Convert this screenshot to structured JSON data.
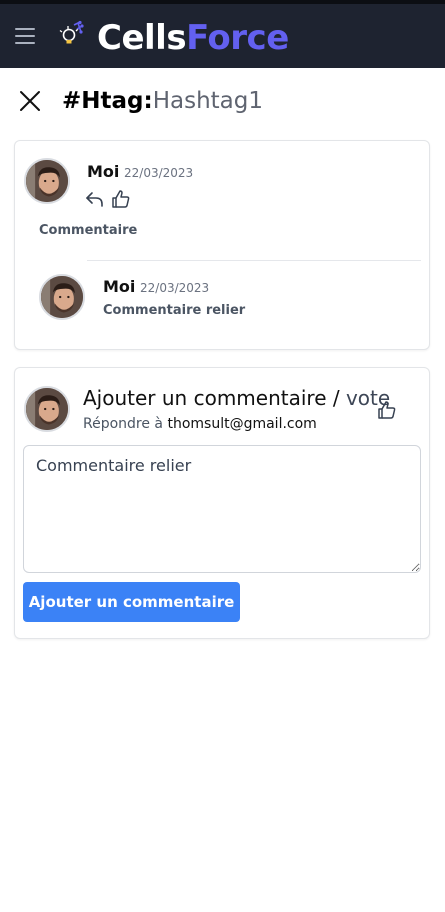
{
  "navbar": {
    "brand_part1": "Cells",
    "brand_part2": "Force",
    "menu_icon": "hamburger-icon",
    "logo_icon": "lightbulb-icon"
  },
  "header": {
    "tag_key": "#Htag:",
    "tag_value": "Hashtag1",
    "close_icon": "close-icon"
  },
  "thread": {
    "main_comment": {
      "author": "Moi",
      "date": "22/03/2023",
      "text": "Commentaire",
      "actions": [
        "reply-icon",
        "thumbs-up-icon"
      ]
    },
    "replies": [
      {
        "author": "Moi",
        "date": "22/03/2023",
        "text": "Commentaire relier"
      }
    ]
  },
  "form": {
    "title": "Ajouter un commentaire",
    "title_sep": " / ",
    "title_vote": "vote",
    "reply_prefix": "Répondre à ",
    "reply_email": "thomsult@gmail.com",
    "textarea_value": "Commentaire relier",
    "submit_label": "Ajouter un commentaire",
    "vote_icon": "thumbs-up-icon"
  },
  "colors": {
    "navbar_bg": "#1e2330",
    "brand_accent": "#6360f0",
    "button_primary": "#3b82f6"
  }
}
